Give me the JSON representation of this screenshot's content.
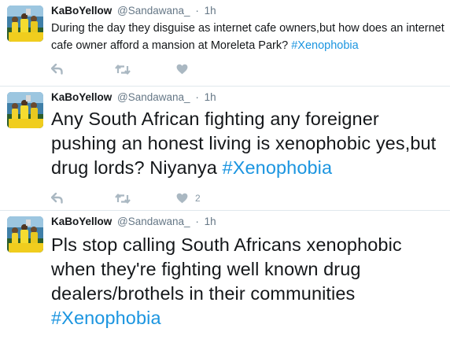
{
  "colors": {
    "hashtag": "#1b95e0",
    "secondary_text": "#657786",
    "action_icon": "#aab8c2",
    "divider": "#e1e8ed"
  },
  "icons": {
    "reply": "reply-icon",
    "retweet": "retweet-icon",
    "like": "heart-icon",
    "avatar": "profile-photo"
  },
  "tweets": [
    {
      "display_name": "KaBoYellow",
      "handle": "@Sandawana_",
      "separator": "·",
      "time": "1h",
      "text": "During the day they disguise as internet cafe owners,but how does an internet cafe owner afford a mansion at Moreleta Park? ",
      "hashtag": "#Xenophobia",
      "like_count": ""
    },
    {
      "display_name": "KaBoYellow",
      "handle": "@Sandawana_",
      "separator": "·",
      "time": "1h",
      "text": "Any South African fighting any foreigner pushing an honest living is xenophobic yes,but drug lords? Niyanya ",
      "hashtag": "#Xenophobia",
      "like_count": "2"
    },
    {
      "display_name": "KaBoYellow",
      "handle": "@Sandawana_",
      "separator": "·",
      "time": "1h",
      "text": "Pls stop calling South Africans xenophobic when they're fighting well known drug dealers/brothels in their communities ",
      "hashtag": "#Xenophobia",
      "like_count": ""
    }
  ]
}
